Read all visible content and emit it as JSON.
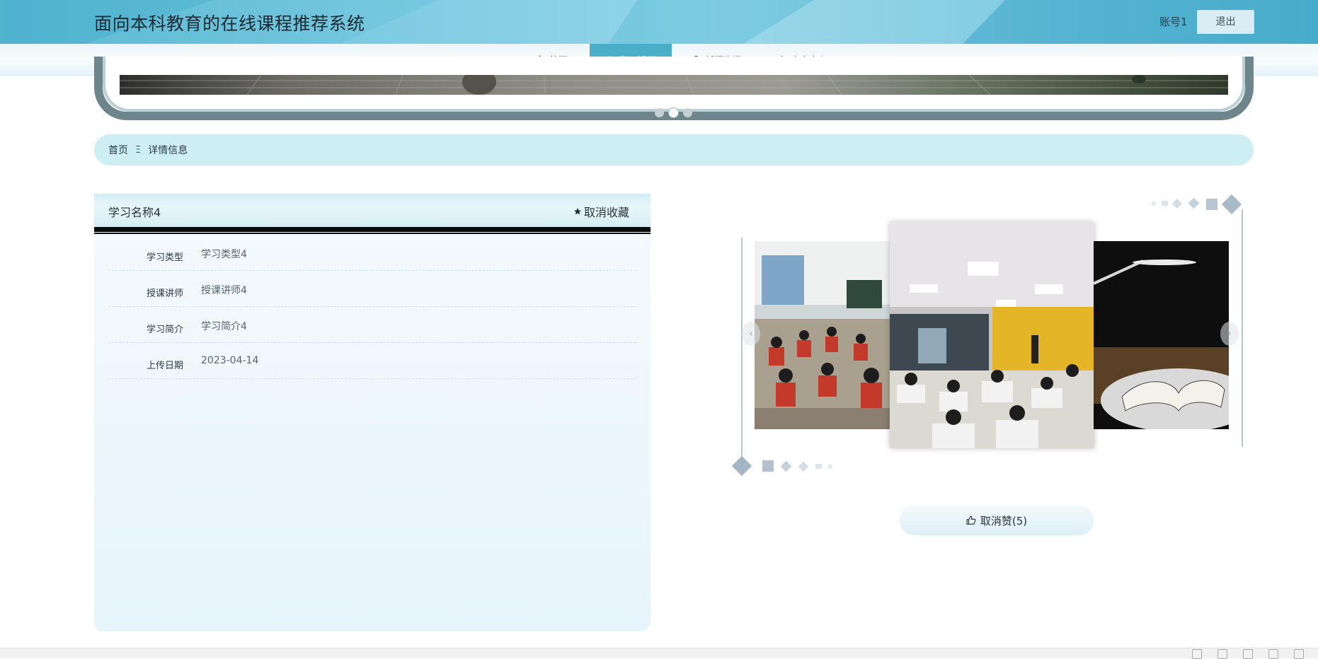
{
  "header": {
    "site_title": "面向本科教育的在线课程推荐系统",
    "account": "账号1",
    "logout_label": "退出"
  },
  "nav": {
    "items": [
      {
        "label": "首页",
        "icon": "star-outline-icon"
      },
      {
        "label": "学习视频",
        "icon": "house-icon"
      },
      {
        "label": "新闻资讯",
        "icon": "alert-circle-icon"
      },
      {
        "label": "个人中心",
        "icon": "user-icon"
      }
    ],
    "active_index": 1
  },
  "banner": {
    "dot_count": 3,
    "active_dot": 1
  },
  "breadcrumb": {
    "home": "首页",
    "separator": "Ξ",
    "current": "详情信息"
  },
  "detail": {
    "title": "学习名称4",
    "unfavorite_label": "取消收藏",
    "rows": [
      {
        "label": "学习类型",
        "value": "学习类型4"
      },
      {
        "label": "授课讲师",
        "value": "授课讲师4"
      },
      {
        "label": "学习简介",
        "value": "学习简介4"
      },
      {
        "label": "上传日期",
        "value": "2023-04-14"
      }
    ]
  },
  "carousel": {
    "prev_label": "‹",
    "next_label": "›"
  },
  "like": {
    "label": "取消赞(5)"
  },
  "colors": {
    "header_primary": "#4aaec9",
    "nav_active": "#4aaec9",
    "breadcrumb_bg": "#cdeef3",
    "deco_shape": "#9fb2c1"
  }
}
